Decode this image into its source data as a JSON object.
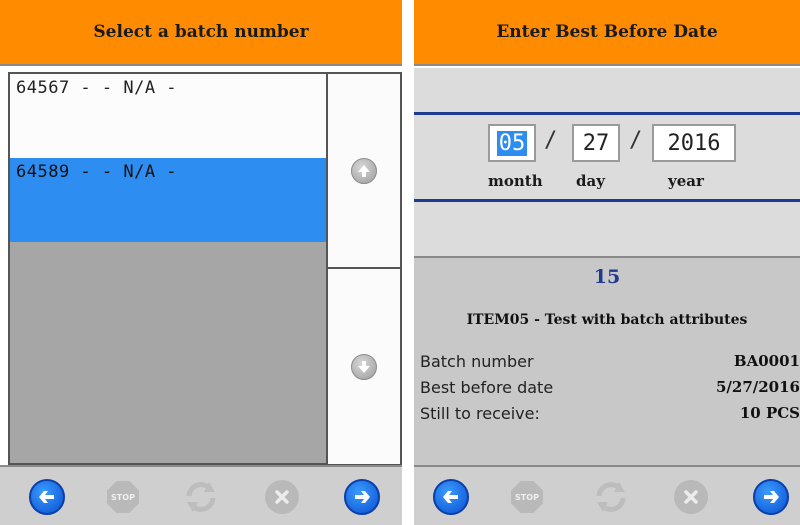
{
  "left": {
    "header": "Select a batch number",
    "items": [
      {
        "text": "64567 -  - N/A -"
      },
      {
        "text": "64589 -  - N/A -"
      }
    ]
  },
  "right": {
    "header": "Enter Best Before Date",
    "date": {
      "month": "05",
      "day": "27",
      "year": "2016",
      "separator": "/",
      "month_label": "month",
      "day_label": "day",
      "year_label": "year"
    },
    "quantity": "15",
    "item_title": "ITEM05 - Test with batch attributes",
    "rows": [
      {
        "label": "Batch number",
        "value": "BA0001"
      },
      {
        "label": "Best before date",
        "value": "5/27/2016"
      },
      {
        "label": "Still to receive:",
        "value": "10 PCS"
      }
    ]
  },
  "toolbar": {
    "stop_label": "STOP"
  },
  "colors": {
    "header_orange": "#ff8c00",
    "selection_blue": "#2e8df0",
    "nav_blue": "#1466e6",
    "accent_navy": "#1f3b8f"
  },
  "icons": [
    "arrow-left-icon",
    "stop-icon",
    "refresh-icon",
    "cancel-icon",
    "arrow-right-icon",
    "scroll-up-icon",
    "scroll-down-icon"
  ]
}
